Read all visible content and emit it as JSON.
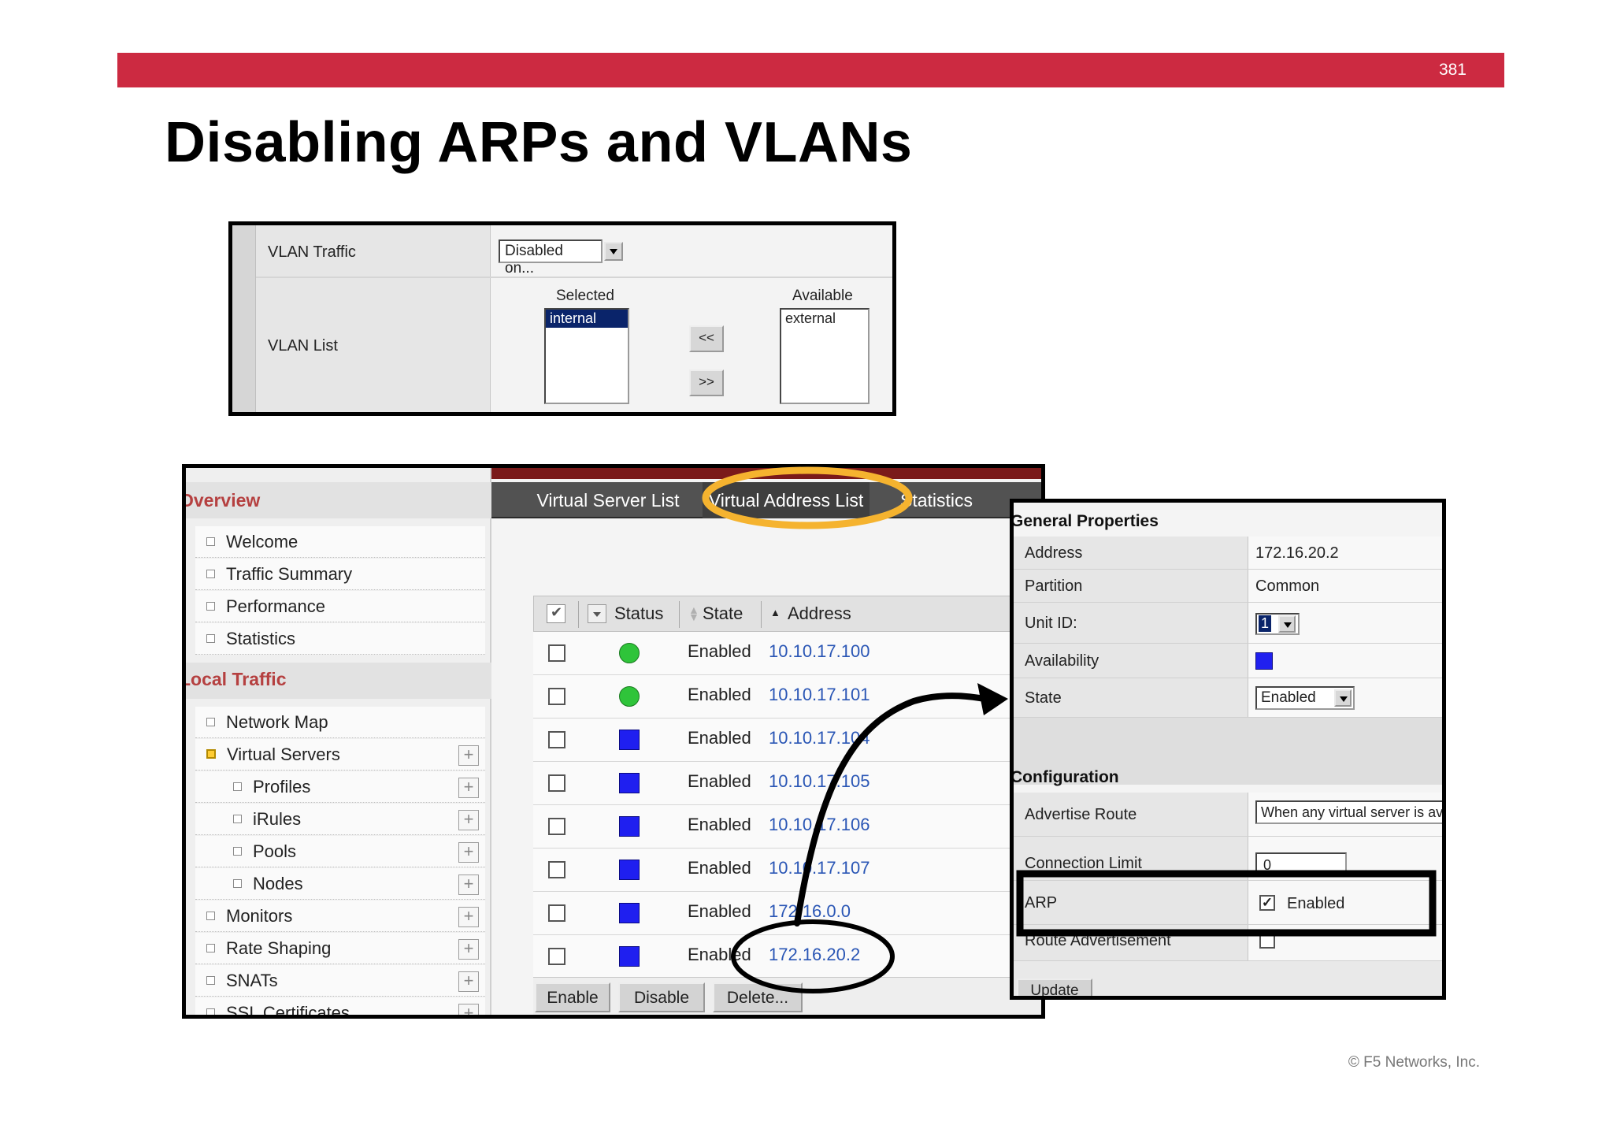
{
  "slide": {
    "page_number": "381",
    "title": "Disabling ARPs and VLANs",
    "copyright": "© F5 Networks, Inc."
  },
  "vlan_panel": {
    "vlan_traffic_label": "VLAN Traffic",
    "vlan_traffic_value": "Disabled on...",
    "vlan_list_label": "VLAN List",
    "selected_header": "Selected",
    "available_header": "Available",
    "selected_items": [
      "internal"
    ],
    "available_items": [
      "external"
    ],
    "move_left_label": "<<",
    "move_right_label": ">>"
  },
  "nav": {
    "overview_title": "Overview",
    "overview_items": [
      "Welcome",
      "Traffic Summary",
      "Performance",
      "Statistics"
    ],
    "local_traffic_title": "Local Traffic",
    "local_items": [
      {
        "label": "Network Map"
      },
      {
        "label": "Virtual Servers"
      },
      {
        "label": "Profiles"
      },
      {
        "label": "iRules"
      },
      {
        "label": "Pools"
      },
      {
        "label": "Nodes"
      },
      {
        "label": "Monitors"
      },
      {
        "label": "Rate Shaping"
      },
      {
        "label": "SNATs"
      },
      {
        "label": "SSL Certificates"
      }
    ],
    "plus_label": "+"
  },
  "tabs": [
    {
      "label": "Virtual Server List"
    },
    {
      "label": "Virtual Address List"
    },
    {
      "label": "Statistics"
    }
  ],
  "address_table": {
    "headers": {
      "status": "Status",
      "state": "State",
      "address": "Address"
    },
    "rows": [
      {
        "status": "green",
        "state": "Enabled",
        "address": "10.10.17.100"
      },
      {
        "status": "green",
        "state": "Enabled",
        "address": "10.10.17.101"
      },
      {
        "status": "blue",
        "state": "Enabled",
        "address": "10.10.17.104"
      },
      {
        "status": "blue",
        "state": "Enabled",
        "address": "10.10.17.105"
      },
      {
        "status": "blue",
        "state": "Enabled",
        "address": "10.10.17.106"
      },
      {
        "status": "blue",
        "state": "Enabled",
        "address": "10.10.17.107"
      },
      {
        "status": "blue",
        "state": "Enabled",
        "address": "172.16.0.0"
      },
      {
        "status": "blue",
        "state": "Enabled",
        "address": "172.16.20.2"
      }
    ],
    "buttons": {
      "enable": "Enable",
      "disable": "Disable",
      "delete": "Delete..."
    }
  },
  "properties": {
    "general_title": "General Properties",
    "address_label": "Address",
    "address_value": "172.16.20.2",
    "partition_label": "Partition",
    "partition_value": "Common",
    "unit_id_label": "Unit ID:",
    "unit_id_value": "1",
    "availability_label": "Availability",
    "state_label": "State",
    "state_value": "Enabled",
    "config_title": "Configuration",
    "advertise_route_label": "Advertise Route",
    "advertise_route_value": "When any virtual server is available",
    "connection_limit_label": "Connection Limit",
    "connection_limit_value": "0",
    "arp_label": "ARP",
    "arp_checked_value": "Enabled",
    "route_adv_label": "Route Advertisement",
    "update_label": "Update"
  },
  "colors": {
    "brand_red": "#cc2a41",
    "highlight_orange": "#f5b32f",
    "link_blue": "#2a56b5",
    "status_green": "#2fc43a",
    "status_blue": "#1f1ff0"
  }
}
